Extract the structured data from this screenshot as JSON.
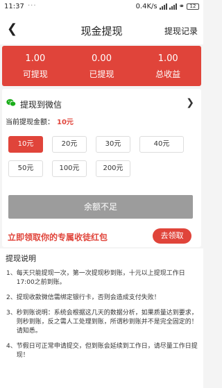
{
  "status_bar": {
    "time": "11:37",
    "dots": "···",
    "network_speed": "0.4K/s",
    "battery": "12"
  },
  "nav": {
    "back_icon": "chevron-left",
    "title": "现金提现",
    "record_label": "提现记录"
  },
  "stats": [
    {
      "value": "1.00",
      "label": "可提现"
    },
    {
      "value": "0.00",
      "label": "已提现"
    },
    {
      "value": "1.00",
      "label": "总收益"
    }
  ],
  "withdraw": {
    "method_label": "提现到微信",
    "current_amount_label": "当前提现金额：",
    "current_amount": "10元",
    "options": [
      "10元",
      "20元",
      "30元",
      "40元",
      "50元",
      "100元",
      "200元"
    ],
    "selected_index": 0,
    "submit_label": "余额不足",
    "promo_text": "立即领取你的专属收徒红包",
    "claim_label": "去领取"
  },
  "colors": {
    "accent": "#e0443a",
    "wechat_green": "#1aad19",
    "disabled_button": "#9c9c9c"
  },
  "notes": {
    "title": "提现说明",
    "items": [
      {
        "num": "1、",
        "text": "每天只能提现一次，第一次提现秒到账，十元以上提现工作日17:00之前到账。"
      },
      {
        "num": "2、",
        "text": "提现收款微信需绑定银行卡，否则会造成支付失败！"
      },
      {
        "num": "3、",
        "text": "秒到账说明：系统会根据这几天的数据分析，如果质量达到要求，则秒到账，反之需人工处理到账，所谓秒到账并不是完全固定的！请知悉。"
      },
      {
        "num": "4、",
        "text": "节假日可正常申请提交，但到账会延续到工作日，请尽量工作日提现！"
      }
    ]
  }
}
